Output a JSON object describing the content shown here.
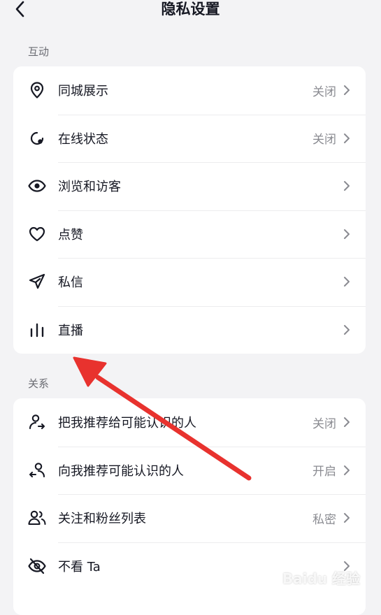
{
  "header": {
    "title": "隐私设置"
  },
  "sections": [
    {
      "label": "互动",
      "rows": [
        {
          "label": "同城展示",
          "value": "关闭",
          "icon": "location-pin-icon"
        },
        {
          "label": "在线状态",
          "value": "关闭",
          "icon": "online-status-icon"
        },
        {
          "label": "浏览和访客",
          "value": "",
          "icon": "eye-icon"
        },
        {
          "label": "点赞",
          "value": "",
          "icon": "heart-icon"
        },
        {
          "label": "私信",
          "value": "",
          "icon": "paper-plane-icon"
        },
        {
          "label": "直播",
          "value": "",
          "icon": "live-bars-icon"
        }
      ]
    },
    {
      "label": "关系",
      "rows": [
        {
          "label": "把我推荐给可能认识的人",
          "value": "关闭",
          "icon": "user-share-icon"
        },
        {
          "label": "向我推荐可能认识的人",
          "value": "开启",
          "icon": "user-recommend-icon"
        },
        {
          "label": "关注和粉丝列表",
          "value": "私密",
          "icon": "users-icon"
        },
        {
          "label": "不看 Ta",
          "value": "",
          "icon": "eye-off-icon"
        }
      ]
    }
  ],
  "watermark": "Baidu 经验",
  "colors": {
    "annotation_arrow": "#e8322e",
    "text_primary": "#161823",
    "text_secondary": "#8a8b91"
  }
}
